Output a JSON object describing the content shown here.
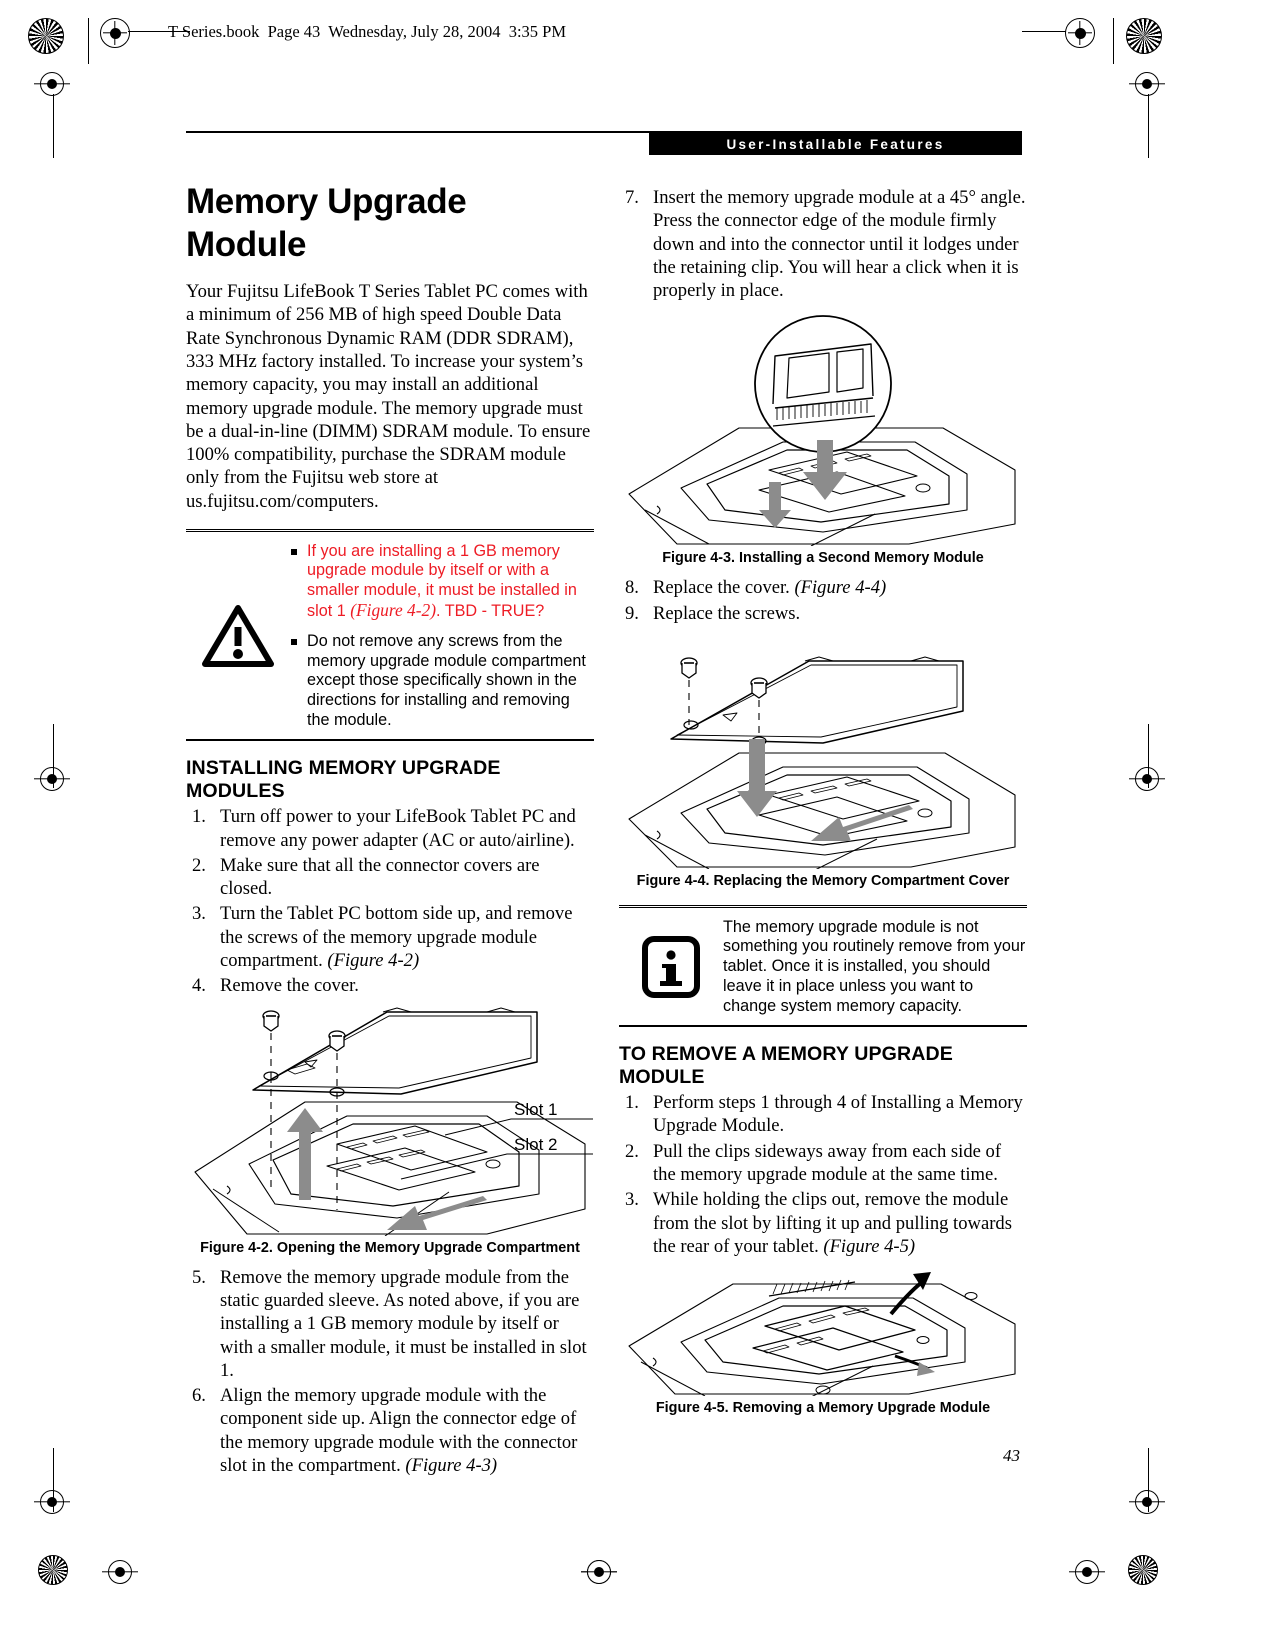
{
  "document": {
    "file_slug": "T Series.book  Page 43  Wednesday, July 28, 2004  3:35 PM",
    "running_head": "User-Installable Features",
    "page_number": "43"
  },
  "colors": {
    "warning_red": "#ee1c25",
    "runhead_bg": "#000000",
    "runhead_text": "#ffffff",
    "arrow_gray": "#8c8c8c"
  },
  "left_column": {
    "title": "Memory Upgrade Module",
    "intro": "Your Fujitsu LifeBook T Series Tablet PC comes with a minimum of 256 MB of high speed Double Data Rate Synchronous Dynamic RAM (DDR SDRAM), 333 MHz factory installed. To increase your system’s memory capacity, you may install an additional memory upgrade module. The memory upgrade must be a dual-in-line (DIMM) SDRAM module. To ensure 100% compatibility, purchase the SDRAM module only from the Fujitsu web store at us.fujitsu.com/computers.",
    "warning": {
      "icon": "warning-triangle-icon",
      "bullets": [
        {
          "parts": [
            {
              "text": "If you are installing a 1 GB memory upgrade module by itself or with a smaller module, it must be installed in slot 1 ",
              "style": "plain"
            },
            {
              "text": "(Figure 4-2)",
              "style": "italic"
            },
            {
              "text": ". TBD - TRUE?",
              "style": "plain"
            }
          ],
          "red": true
        },
        {
          "parts": [
            {
              "text": "Do not remove any screws from the memory upgrade module compartment except those specifically shown in the directions for installing and removing the module.",
              "style": "plain"
            }
          ],
          "red": false
        }
      ]
    },
    "install_heading": "INSTALLING MEMORY UPGRADE MODULES",
    "install_steps": [
      {
        "num": "1.",
        "text": "Turn off power to your LifeBook Tablet PC and remove any power adapter (AC or auto/airline).",
        "ref": ""
      },
      {
        "num": "2.",
        "text": "Make sure that all the connector covers are closed.",
        "ref": ""
      },
      {
        "num": "3.",
        "text": "Turn the Tablet PC bottom side up, and remove the screws of the memory upgrade module compartment. ",
        "ref": "(Figure 4-2)"
      },
      {
        "num": "4.",
        "text": "Remove the cover.",
        "ref": ""
      }
    ],
    "figure_4_2": {
      "caption": "Figure 4-2. Opening the Memory Upgrade Compartment",
      "label_slot1": "Slot 1",
      "label_slot2": "Slot 2"
    },
    "install_steps_2": [
      {
        "num": "5.",
        "text": "Remove the memory upgrade module from the static guarded sleeve. As noted above, if you are installing a 1 GB memory module by itself or with a smaller module, it must be installed in slot 1.",
        "ref": ""
      },
      {
        "num": "6.",
        "text": "Align the memory upgrade module with the component side up. Align the connector edge of the memory upgrade module with the connector slot in the compartment. ",
        "ref": "(Figure 4-3)"
      }
    ]
  },
  "right_column": {
    "step_7": {
      "num": "7.",
      "text": "Insert the memory upgrade module at a 45° angle. Press the connector edge of the module firmly down and into the connector until it lodges under the retaining clip. You will hear a click when it is properly in place.",
      "ref": ""
    },
    "figure_4_3": {
      "caption": "Figure 4-3. Installing a Second Memory Module"
    },
    "steps_8_9": [
      {
        "num": "8.",
        "text": "Replace the cover. ",
        "ref": "(Figure 4-4)"
      },
      {
        "num": "9.",
        "text": "Replace the screws.",
        "ref": ""
      }
    ],
    "figure_4_4": {
      "caption": "Figure 4-4. Replacing the Memory Compartment Cover"
    },
    "note": {
      "icon": "info-icon",
      "text": "The memory upgrade module is not something you routinely remove from your tablet. Once it is installed, you should leave it in place unless you want to change system memory capacity."
    },
    "remove_heading": "TO REMOVE A MEMORY UPGRADE MODULE",
    "remove_steps": [
      {
        "num": "1.",
        "text": "Perform steps 1 through 4 of Installing a Memory Upgrade Module.",
        "ref": ""
      },
      {
        "num": "2.",
        "text": "Pull the clips sideways away from each side of the memory upgrade module at the same time.",
        "ref": ""
      },
      {
        "num": "3.",
        "text": "While holding the clips out, remove the module from the slot by lifting it up and pulling towards the rear of your tablet. ",
        "ref": "(Figure 4-5)"
      }
    ],
    "figure_4_5": {
      "caption": "Figure 4-5. Removing a Memory Upgrade Module"
    }
  }
}
